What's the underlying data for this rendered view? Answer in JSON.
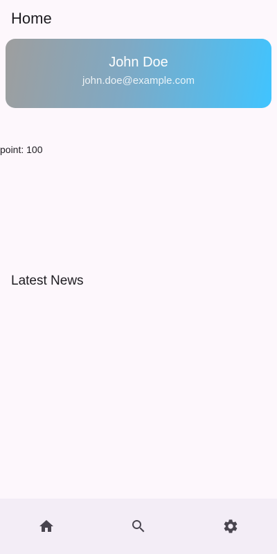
{
  "app_bar": {
    "title": "Home"
  },
  "profile": {
    "name": "John Doe",
    "email": "john.doe@example.com",
    "gradient_colors": [
      "#9e9e9e",
      "#40c4ff"
    ]
  },
  "points": {
    "label": "point: 100"
  },
  "news": {
    "title": "Latest News"
  },
  "bottom_nav": {
    "items": [
      {
        "icon": "home-icon"
      },
      {
        "icon": "search-icon"
      },
      {
        "icon": "settings-icon"
      }
    ],
    "icon_color": "#49454f",
    "background": "#f3edf6"
  },
  "colors": {
    "background": "#fdf7fc",
    "text": "#1d1b20"
  }
}
